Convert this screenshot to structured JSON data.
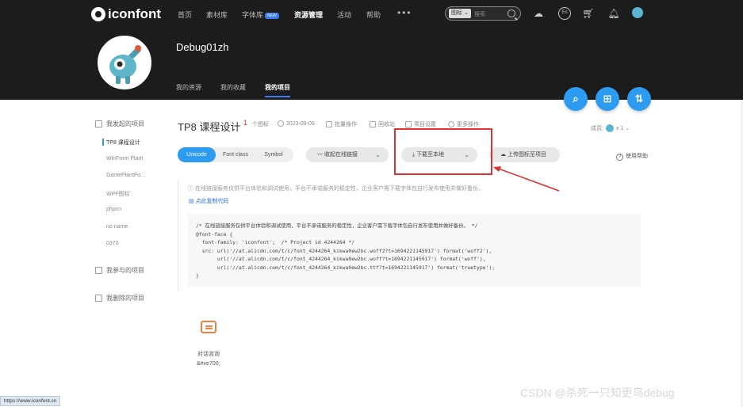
{
  "header": {
    "logo_text": "iconfont",
    "nav": [
      "首页",
      "素材库",
      "字体库",
      "资源管理",
      "活动",
      "帮助"
    ],
    "nav_badge": "NEW",
    "nav_more": "•••",
    "search_type": "图标 ⌄",
    "search_placeholder": "搜索",
    "lang_label": "En"
  },
  "profile": {
    "username": "Debug01zh",
    "tabs": [
      "我的资源",
      "我的收藏",
      "我的项目"
    ],
    "active_tab": "我的项目"
  },
  "fabs": [
    "search-icon",
    "add-project-icon",
    "sort-icon"
  ],
  "sidebar": {
    "group_started": "我发起的项目",
    "projects": [
      "TP8 课程设计",
      "WinForm Plant",
      "GamePlantFo...",
      "WPF图标",
      "phpcn",
      "no name",
      "0370"
    ],
    "group_joined": "我参与的项目",
    "group_deleted": "我删除的项目"
  },
  "project": {
    "title": "TP8 课程设计",
    "icon_count": "1",
    "icon_count_suffix": "个图标",
    "date": "2023-09-09",
    "batch_ops": "批量操作",
    "recycle": "回收站",
    "settings": "项目设置",
    "more_ops": "更多操作",
    "members_label": "成员:",
    "members_count": "x 1"
  },
  "toolbar": {
    "formats": [
      "Unicode",
      "Font class",
      "Symbol"
    ],
    "active_format": "Unicode",
    "online_link": "收起在线链接",
    "download": "下载至本地",
    "upload": "上传图标至项目",
    "help": "使用帮助"
  },
  "notice": "在线链接服务仅供平台体验和调试使用，平台不承诺服务的稳定性，企业客户需下载字体包自行发布使用并做好备份。",
  "copy_link": "点此复制代码",
  "code_lines": [
    "/* 在线链接服务仅供平台体验和调试使用，平台不承诺服务的稳定性，企业客户需下载字体包自行发布使用并做好备份。 */",
    "@font-face {",
    "  font-family: 'iconfont';  /* Project id 4244264 */",
    "  src: url('//at.alicdn.com/t/c/font_4244264_kikwa0ew2bc.woff2?t=1694221145917') format('woff2'),",
    "       url('//at.alicdn.com/t/c/font_4244264_kikwa0ew2bc.woff?t=1694221145917') format('woff'),",
    "       url('//at.alicdn.com/t/c/font_4244264_kikwa0ew2bc.ttf?t=1694221145917') format('truetype');",
    "}"
  ],
  "icon_card": {
    "label": "对话咨询",
    "code": "&#xe700;"
  },
  "status_url": "https://www.iconfont.cn",
  "watermark": "CSDN @杀死一只知更鸟debug",
  "colors": {
    "accent": "#2d9bf0",
    "highlight": "#e03030",
    "header_bg": "#1c1c1c"
  }
}
